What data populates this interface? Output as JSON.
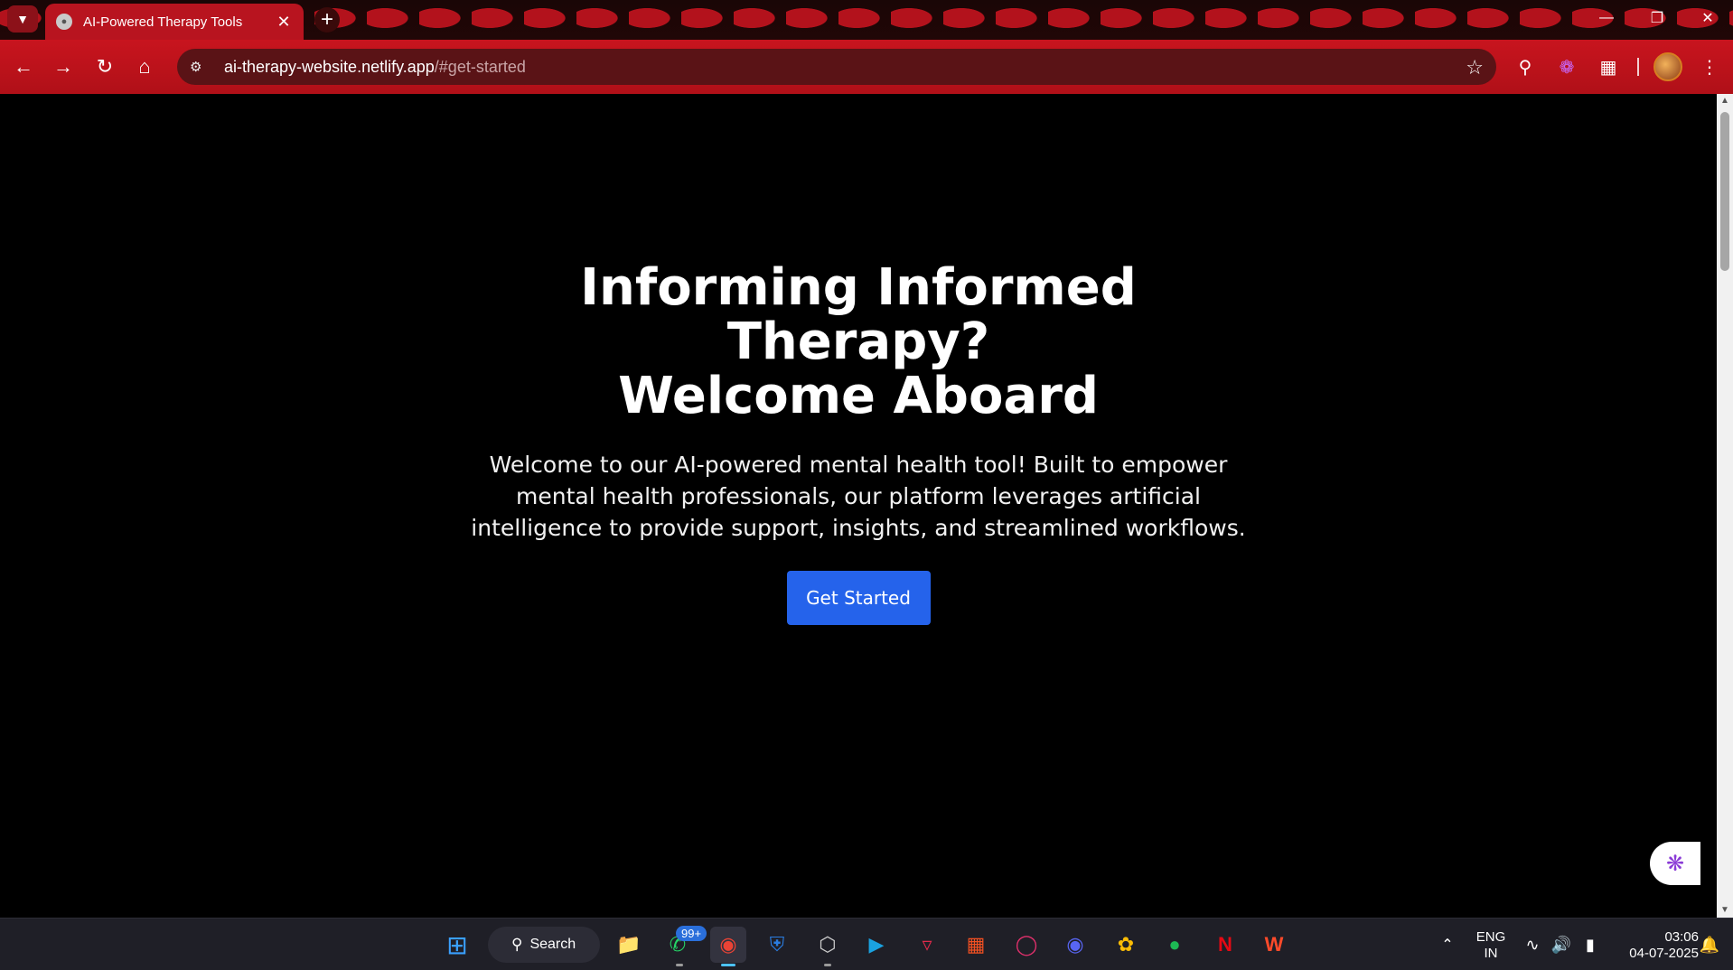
{
  "browser": {
    "tab": {
      "title": "AI-Powered Therapy Tools"
    },
    "address": {
      "host": "ai-therapy-website.netlify.app",
      "path": "/#get-started"
    }
  },
  "page": {
    "hero": {
      "title_line1": "Informing Informed Therapy?",
      "title_line2": "Welcome Aboard",
      "description": "Welcome to our AI-powered mental health tool! Built to empower mental health professionals, our platform leverages artificial intelligence to provide support, insights, and streamlined workflows.",
      "cta_label": "Get Started"
    },
    "colors": {
      "cta": "#2563eb",
      "background": "#000000",
      "chrome": "#c8141e"
    }
  },
  "taskbar": {
    "search_label": "Search",
    "whatsapp_badge": "99+",
    "language": {
      "line1": "ENG",
      "line2": "IN"
    },
    "clock": {
      "time": "03:06",
      "date": "04-07-2025"
    }
  }
}
